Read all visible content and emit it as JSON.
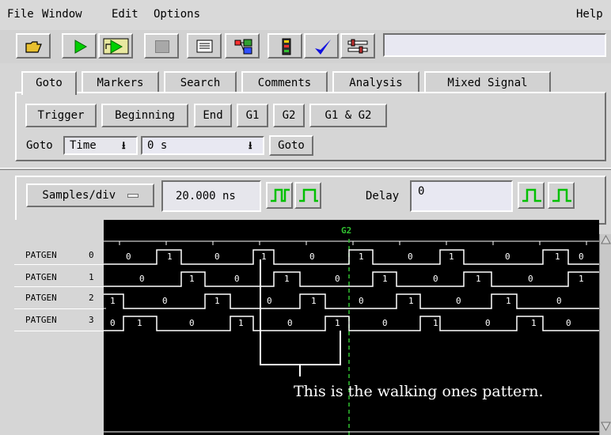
{
  "menubar": {
    "items": [
      "File",
      "Window",
      "Edit",
      "Options"
    ],
    "help": "Help"
  },
  "tabs": [
    "Goto",
    "Markers",
    "Search",
    "Comments",
    "Analysis",
    "Mixed Signal"
  ],
  "goto": {
    "buttons": [
      "Trigger",
      "Beginning",
      "End",
      "G1",
      "G2",
      "G1 & G2"
    ],
    "label": "Goto",
    "mode": "Time",
    "value": "0 s",
    "go_label": "Goto"
  },
  "timebase": {
    "samples_label": "Samples/div",
    "samples_value": "20.000 ns",
    "delay_label": "Delay",
    "delay_value": "0"
  },
  "marker": "G2",
  "channels": [
    {
      "name": "PATGEN",
      "num": "0",
      "bits": [
        "0",
        "1",
        "0",
        "1",
        "0",
        "1",
        "0",
        "1",
        "0",
        "1",
        "0"
      ]
    },
    {
      "name": "PATGEN",
      "num": "1",
      "bits": [
        "0",
        "1",
        "0",
        "1",
        "0",
        "1",
        "0",
        "1",
        "0",
        "1"
      ]
    },
    {
      "name": "PATGEN",
      "num": "2",
      "bits": [
        "1",
        "0",
        "1",
        "0",
        "1",
        "0",
        "1",
        "0",
        "1",
        "0"
      ]
    },
    {
      "name": "PATGEN",
      "num": "3",
      "bits": [
        "0",
        "1",
        "0",
        "1",
        "0",
        "1",
        "0",
        "1",
        "0",
        "1",
        "0"
      ]
    }
  ],
  "annotation": "This is the walking ones pattern.",
  "colors": {
    "marker": "#30c030",
    "wave": "#ffffff",
    "background": "#000000",
    "run_icon": "#00c000",
    "check_icon": "#1010e0"
  }
}
